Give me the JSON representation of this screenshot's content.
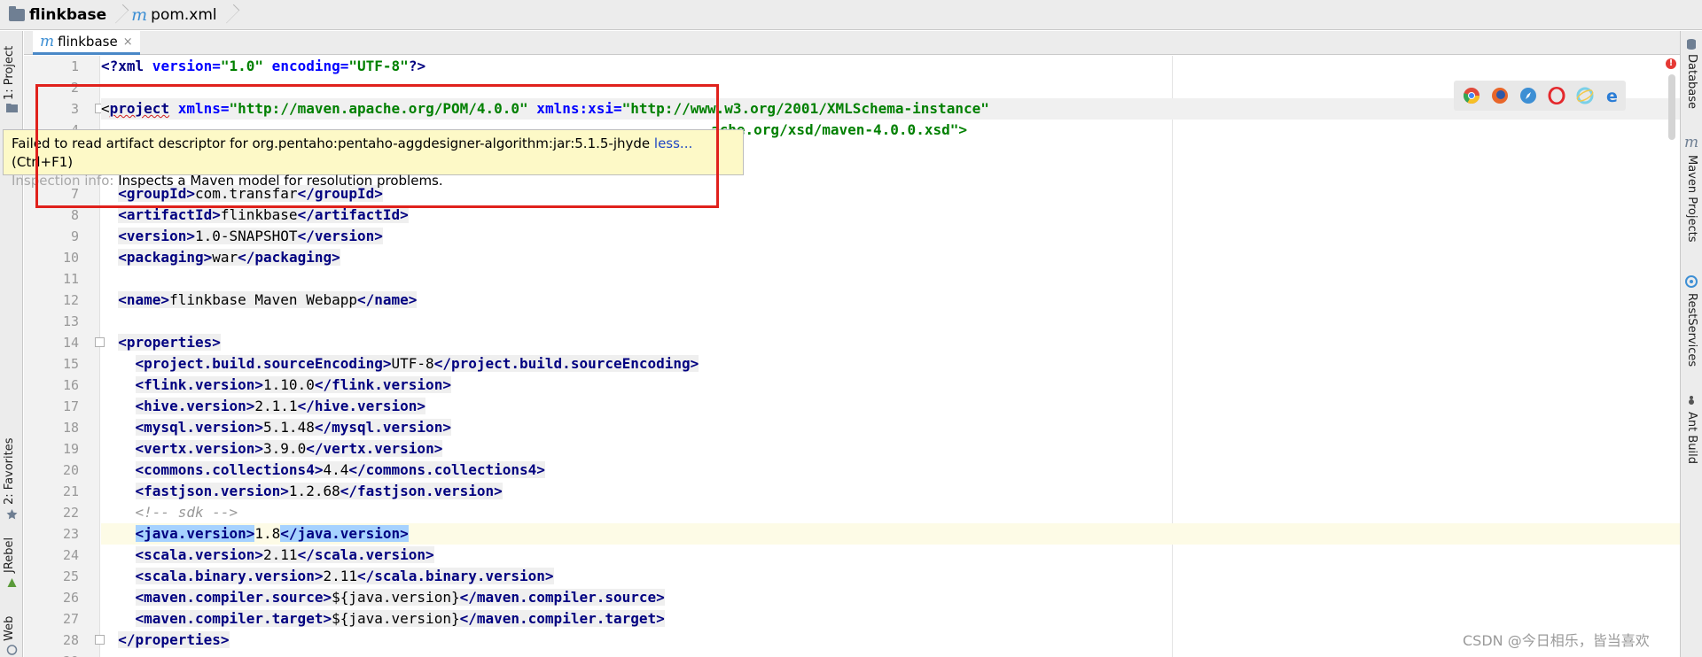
{
  "breadcrumb": {
    "project": "flinkbase",
    "file": "pom.xml"
  },
  "editor_tab": {
    "label": "flinkbase",
    "close": "×"
  },
  "left_tools": {
    "project": "1: Project",
    "favorites": "2: Favorites",
    "jrebel": "JRebel",
    "web": "Web"
  },
  "right_tools": {
    "database": "Database",
    "maven": "Maven Projects",
    "rest": "RestServices",
    "ant": "Ant Build"
  },
  "line_numbers": [
    "1",
    "2",
    "3",
    "4",
    "",
    "",
    "7",
    "8",
    "9",
    "10",
    "11",
    "12",
    "13",
    "14",
    "15",
    "16",
    "17",
    "18",
    "19",
    "20",
    "21",
    "22",
    "23",
    "24",
    "25",
    "26",
    "27",
    "28",
    "29"
  ],
  "code": {
    "l1_a": "<?",
    "l1_b": "xml",
    "l1_c": " version=",
    "l1_d": "\"1.0\"",
    "l1_e": " encoding=",
    "l1_f": "\"UTF-8\"",
    "l1_g": "?>",
    "l3_a": "<",
    "l3_b": "project",
    "l3_c": " xmlns=",
    "l3_d": "\"http://maven.apache.org/POM/4.0.0\"",
    "l3_e": " xmlns:xsi=",
    "l3_f": "\"http://www.w3.org/2001/XMLSchema-instance\"",
    "l4_tail": "ache.org/xsd/maven-4.0.0.xsd\">",
    "groupId": "com.transfar",
    "artifactId": "flinkbase",
    "version": "1.0-SNAPSHOT",
    "packaging": "war",
    "name": "flinkbase Maven Webapp",
    "sourceEncoding": "UTF-8",
    "flink": "1.10.0",
    "hive": "2.1.1",
    "mysql": "5.1.48",
    "vertx": "3.9.0",
    "collections": "4.4",
    "fastjson": "1.2.68",
    "comment": "<!-- sdk -->",
    "java": "1.8",
    "scala": "2.11",
    "scala_binary": "2.11",
    "compiler_source": "${java.version}",
    "compiler_target": "${java.version}"
  },
  "tooltip": {
    "message": "Failed to read artifact descriptor for org.pentaho:pentaho-aggdesigner-algorithm:jar:5.1.5-jhyde ",
    "less": "less...",
    "shortcut": " (Ctrl+F1)",
    "info_label": "Inspection info: ",
    "info_text": "Inspects a Maven model for resolution problems."
  },
  "error_marker": "!",
  "browsers": [
    "chrome-icon",
    "firefox-icon",
    "safari-icon",
    "opera-icon",
    "ie-icon",
    "edge-icon"
  ],
  "watermark": "CSDN @今日相乐，皆当喜欢",
  "colors": {
    "tag": "#000080",
    "attr": "#0000ff",
    "string": "#008000",
    "selection": "#a6d2ff",
    "tooltip_bg": "#fdf9c7",
    "annotation": "#e0211c"
  }
}
